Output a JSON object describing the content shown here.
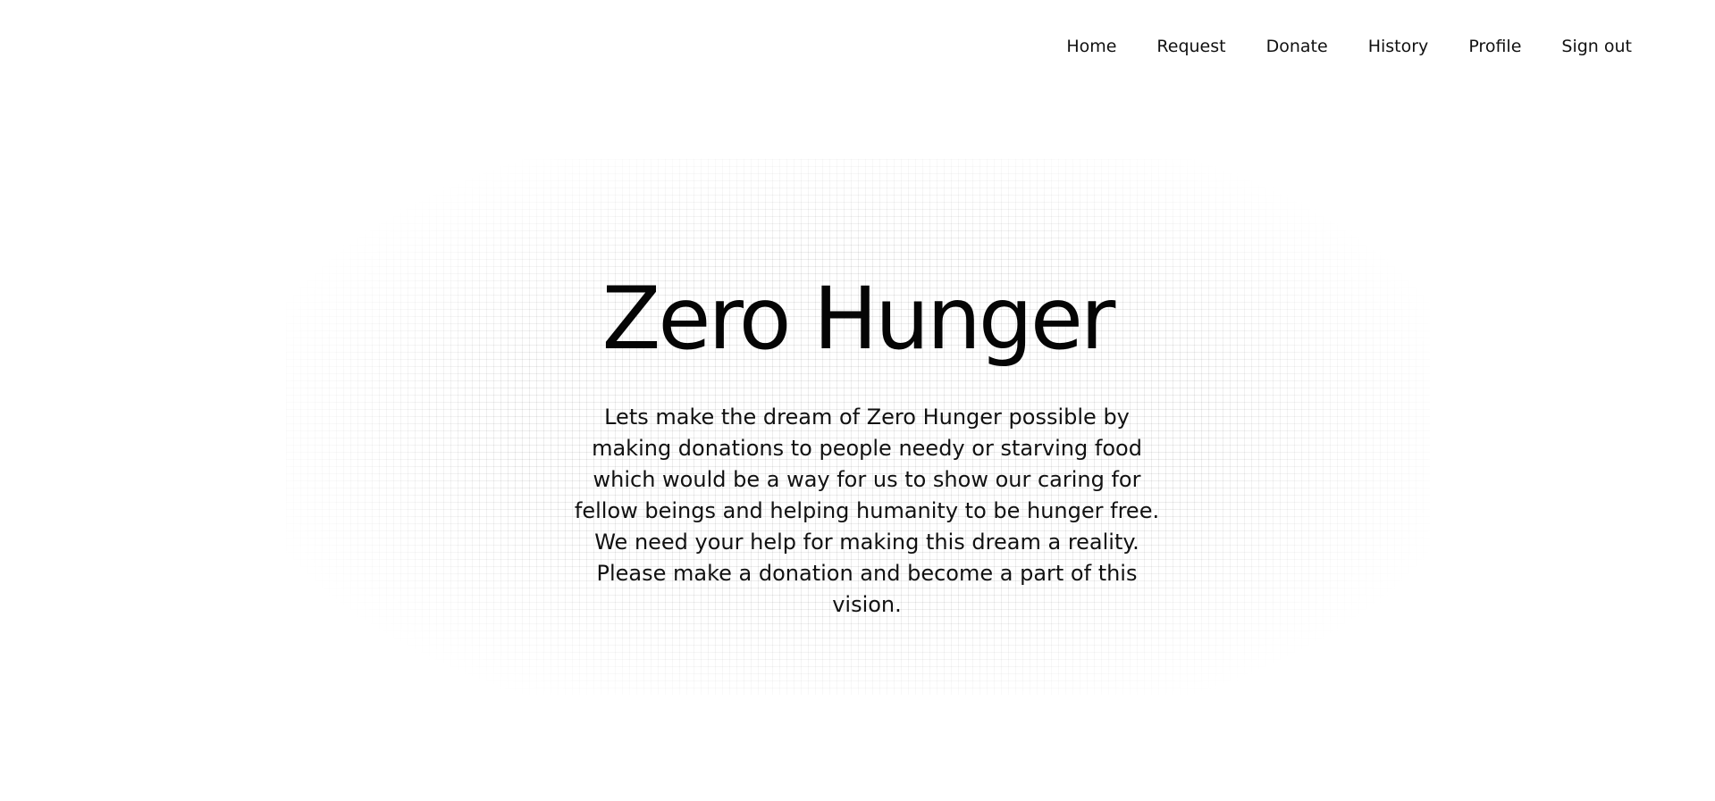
{
  "nav": {
    "items": [
      {
        "label": "Home"
      },
      {
        "label": "Request"
      },
      {
        "label": "Donate"
      },
      {
        "label": "History"
      },
      {
        "label": "Profile"
      },
      {
        "label": "Sign out"
      }
    ]
  },
  "hero": {
    "title": "Zero Hunger",
    "description": "Lets make the dream of Zero Hunger possible by making donations to people needy or starving food which would be a way for us to show our caring for fellow beings and helping humanity to be hunger free. We need your help for making this dream a reality. Please make a donation and become a part of this vision."
  }
}
